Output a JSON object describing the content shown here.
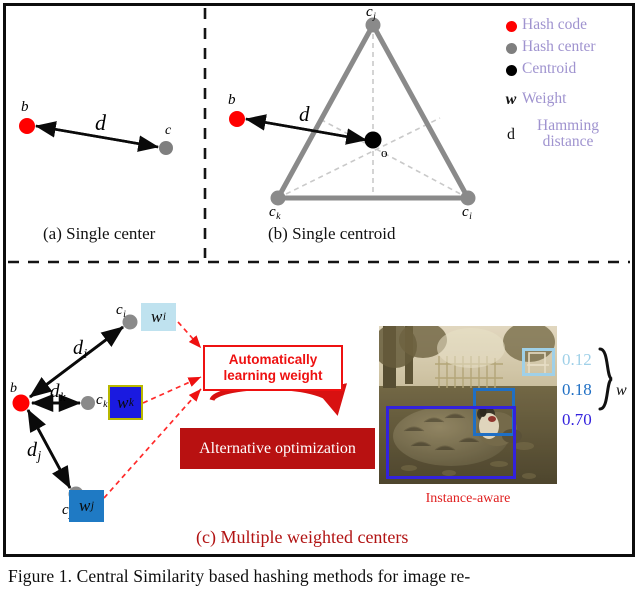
{
  "figure": {
    "caption": "Figure 1. Central Similarity based hashing methods for image re-"
  },
  "legend": {
    "items": [
      {
        "mark": "red-dot",
        "color": "#ff0000",
        "label": "Hash code"
      },
      {
        "mark": "gray-dot",
        "color": "#7f7f7f",
        "label": "Hash center"
      },
      {
        "mark": "black-dot",
        "color": "#000000",
        "label": "Centroid"
      },
      {
        "mark": "w-glyph",
        "glyph": "w",
        "label": "Weight"
      },
      {
        "mark": "d-glyph",
        "glyph": "d",
        "label": "Hamming distance"
      }
    ],
    "text_color": "#9f93cf"
  },
  "panel_a": {
    "caption": "(a) Single center",
    "point_b": "b",
    "point_c": "c",
    "distance": "d"
  },
  "panel_b": {
    "caption": "(b) Single centroid",
    "point_b": "b",
    "point_cj": "c",
    "point_cj_sub": "j",
    "point_ck": "c",
    "point_ck_sub": "k",
    "point_ci": "c",
    "point_ci_sub": "i",
    "centroid": "o",
    "distance": "d"
  },
  "panel_c": {
    "caption": "(c) Multiple weighted centers",
    "point_b": "b",
    "centers": [
      {
        "name": "c",
        "sub": "i",
        "dist": "d",
        "dist_sub": "i",
        "weight": "w",
        "weight_sub": "i",
        "chip_color": "#bfe2ef",
        "chip_border": "#8fc7dd"
      },
      {
        "name": "c",
        "sub": "k",
        "dist": "d",
        "dist_sub": "k",
        "weight": "w",
        "weight_sub": "k",
        "chip_color": "#1a1ae0",
        "chip_border": "#b8b800"
      },
      {
        "name": "c",
        "sub": "j",
        "dist": "d",
        "dist_sub": "j",
        "weight": "w",
        "weight_sub": "j",
        "chip_color": "#1f7ac4",
        "chip_border": "#1f7ac4"
      }
    ],
    "box_auto": "Automatically learning weight",
    "box_alt": "Alternative optimization",
    "instance_label": "Instance-aware",
    "weights": [
      {
        "value": "0.12",
        "color": "#9fd0e8"
      },
      {
        "value": "0.18",
        "color": "#1f6fc4"
      },
      {
        "value": "0.70",
        "color": "#3322dd"
      }
    ],
    "weight_brace_label": "w",
    "photo": {
      "boxes": [
        {
          "name": "chair-box",
          "color": "#9fd0e8"
        },
        {
          "name": "dog-box",
          "color": "#1f6fc4"
        },
        {
          "name": "sheep-box",
          "color": "#3322dd"
        }
      ]
    }
  },
  "colors": {
    "hash_code": "#ff0000",
    "hash_center": "#7f7f7f",
    "centroid": "#000000",
    "accent_red": "#ee1111",
    "dark_red": "#b81111"
  }
}
